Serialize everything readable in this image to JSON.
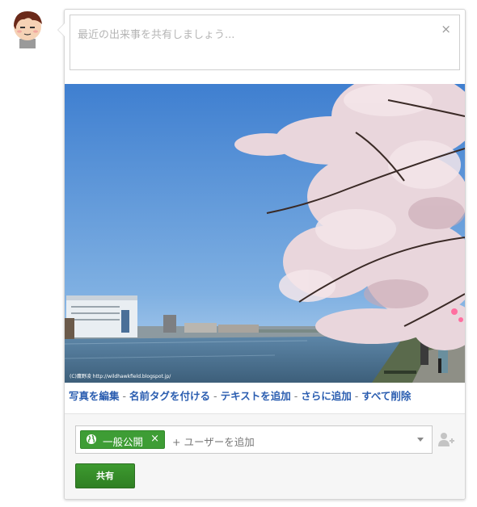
{
  "composer": {
    "placeholder": "最近の出来事を共有しましょう...",
    "close_glyph": "×"
  },
  "photo": {
    "watermark": "(C)鷹野凌 http://wildhawkfield.blogspot.jp/"
  },
  "photo_actions": {
    "edit_photo": "写真を編集",
    "tag_names": "名前タグを付ける",
    "add_text": "テキストを追加",
    "add_more": "さらに追加",
    "delete_all": "すべて削除",
    "separator": "-"
  },
  "audience": {
    "chip_label": "一般公開",
    "chip_remove": "×",
    "add_user_placeholder": "+ ユーザーを追加"
  },
  "share_button_label": "共有",
  "colors": {
    "accent_green": "#3e9d35",
    "link_blue": "#2a5db0"
  },
  "icons": {
    "avatar": "cartoon-avatar",
    "globe": "globe-icon",
    "add_person": "add-person-icon"
  }
}
